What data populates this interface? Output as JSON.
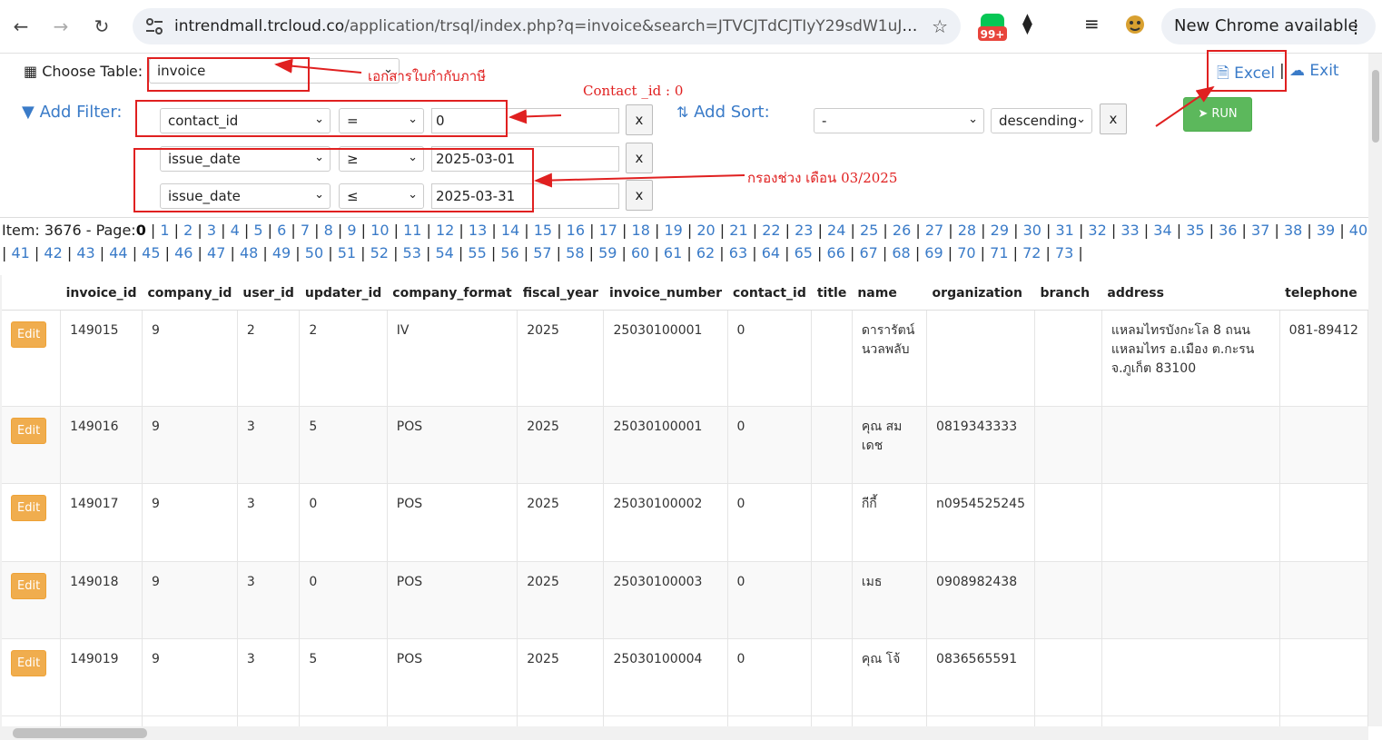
{
  "browser": {
    "url_host": "intrendmall.trcloud.co",
    "url_path": "/application/trsql/index.php?q=invoice&search=JTVCJTdCJTIyY29sdW1uJTIyJ...",
    "badge": "99+",
    "new_chrome": "New Chrome available"
  },
  "toolbar": {
    "choose_table_label": "Choose Table:",
    "table_value": "invoice",
    "excel_label": "Excel",
    "pipe": "|",
    "exit_label": "Exit",
    "add_filter_label": "Add Filter:",
    "add_sort_label": "Add Sort:",
    "run_label": "RUN",
    "x_label": "x",
    "filters": [
      {
        "field": "contact_id",
        "op": "=",
        "value": "0"
      },
      {
        "field": "issue_date",
        "op": "≥",
        "value": "2025-03-01"
      },
      {
        "field": "issue_date",
        "op": "≤",
        "value": "2025-03-31"
      }
    ],
    "sort_field": "-",
    "sort_dir": "descending"
  },
  "annotations": {
    "table_note": "เอกสารใบกำกับภาษี",
    "contact_note": "Contact _id : 0",
    "date_note": "กรองช่วง เดือน 03/2025"
  },
  "pager": {
    "item_label": "Item: 3676 - Page:",
    "current": "0",
    "pages": [
      "1",
      "2",
      "3",
      "4",
      "5",
      "6",
      "7",
      "8",
      "9",
      "10",
      "11",
      "12",
      "13",
      "14",
      "15",
      "16",
      "17",
      "18",
      "19",
      "20",
      "21",
      "22",
      "23",
      "24",
      "25",
      "26",
      "27",
      "28",
      "29",
      "30",
      "31",
      "32",
      "33",
      "34",
      "35",
      "36",
      "37",
      "38",
      "39",
      "40",
      "41",
      "42",
      "43",
      "44",
      "45",
      "46",
      "47",
      "48",
      "49",
      "50",
      "51",
      "52",
      "53",
      "54",
      "55",
      "56",
      "57",
      "58",
      "59",
      "60",
      "61",
      "62",
      "63",
      "64",
      "65",
      "66",
      "67",
      "68",
      "69",
      "70",
      "71",
      "72",
      "73"
    ]
  },
  "table": {
    "edit_label": "Edit",
    "columns": [
      "",
      "invoice_id",
      "company_id",
      "user_id",
      "updater_id",
      "company_format",
      "fiscal_year",
      "invoice_number",
      "contact_id",
      "title",
      "name",
      "organization",
      "branch",
      "address",
      "telephone"
    ],
    "rows": [
      [
        "149015",
        "9",
        "2",
        "2",
        "IV",
        "2025",
        "25030100001",
        "0",
        "",
        "ดารารัตน์ นวลพลับ",
        "",
        "",
        "แหลมไทรบังกะโล 8 ถนนแหลมไทร อ.เมือง ต.กะรน จ.ภูเก็ต 83100",
        "081-89412"
      ],
      [
        "149016",
        "9",
        "3",
        "5",
        "POS",
        "2025",
        "25030100001",
        "0",
        "",
        "คุณ สมเดช",
        "0819343333",
        "",
        "",
        ""
      ],
      [
        "149017",
        "9",
        "3",
        "0",
        "POS",
        "2025",
        "25030100002",
        "0",
        "",
        "กีกี้",
        "n0954525245",
        "",
        "",
        ""
      ],
      [
        "149018",
        "9",
        "3",
        "0",
        "POS",
        "2025",
        "25030100003",
        "0",
        "",
        "เมธ",
        "0908982438",
        "",
        "",
        ""
      ],
      [
        "149019",
        "9",
        "3",
        "5",
        "POS",
        "2025",
        "25030100004",
        "0",
        "",
        "คุณ โจ้",
        "0836565591",
        "",
        "",
        ""
      ]
    ]
  }
}
